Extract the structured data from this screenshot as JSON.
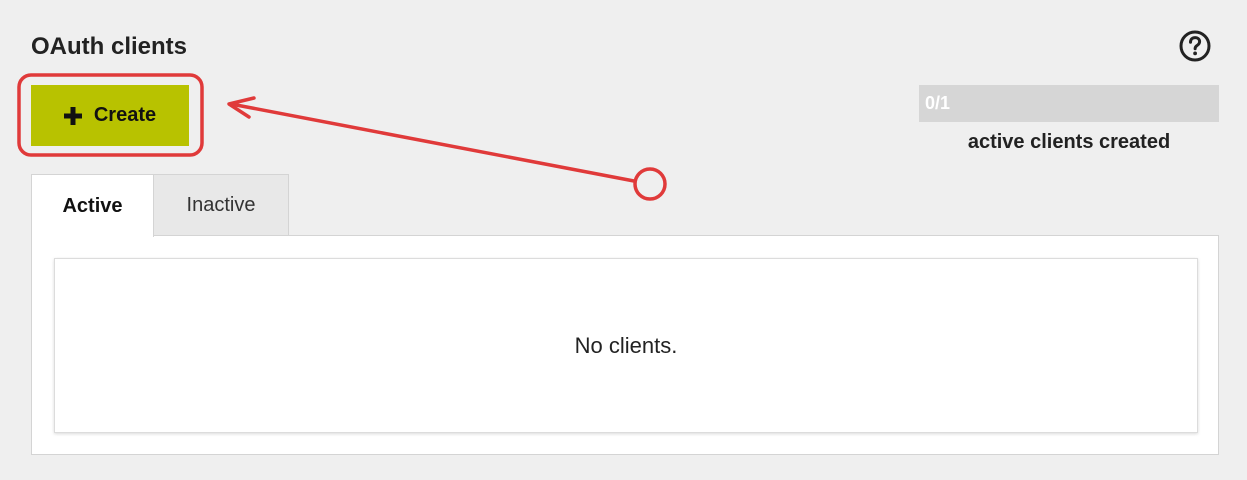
{
  "header": {
    "title": "OAuth clients",
    "help_icon": "help-circle-icon"
  },
  "toolbar": {
    "create_label": "Create",
    "create_icon": "plus-icon"
  },
  "usage": {
    "count_text": "0/1",
    "used": 0,
    "limit": 1,
    "caption": "active clients created"
  },
  "tabs": [
    {
      "label": "Active",
      "selected": true
    },
    {
      "label": "Inactive",
      "selected": false
    }
  ],
  "panel": {
    "empty_message": "No clients."
  },
  "colors": {
    "accent": "#b8c200",
    "annotation": "#e03a3a",
    "background": "#efefef"
  }
}
